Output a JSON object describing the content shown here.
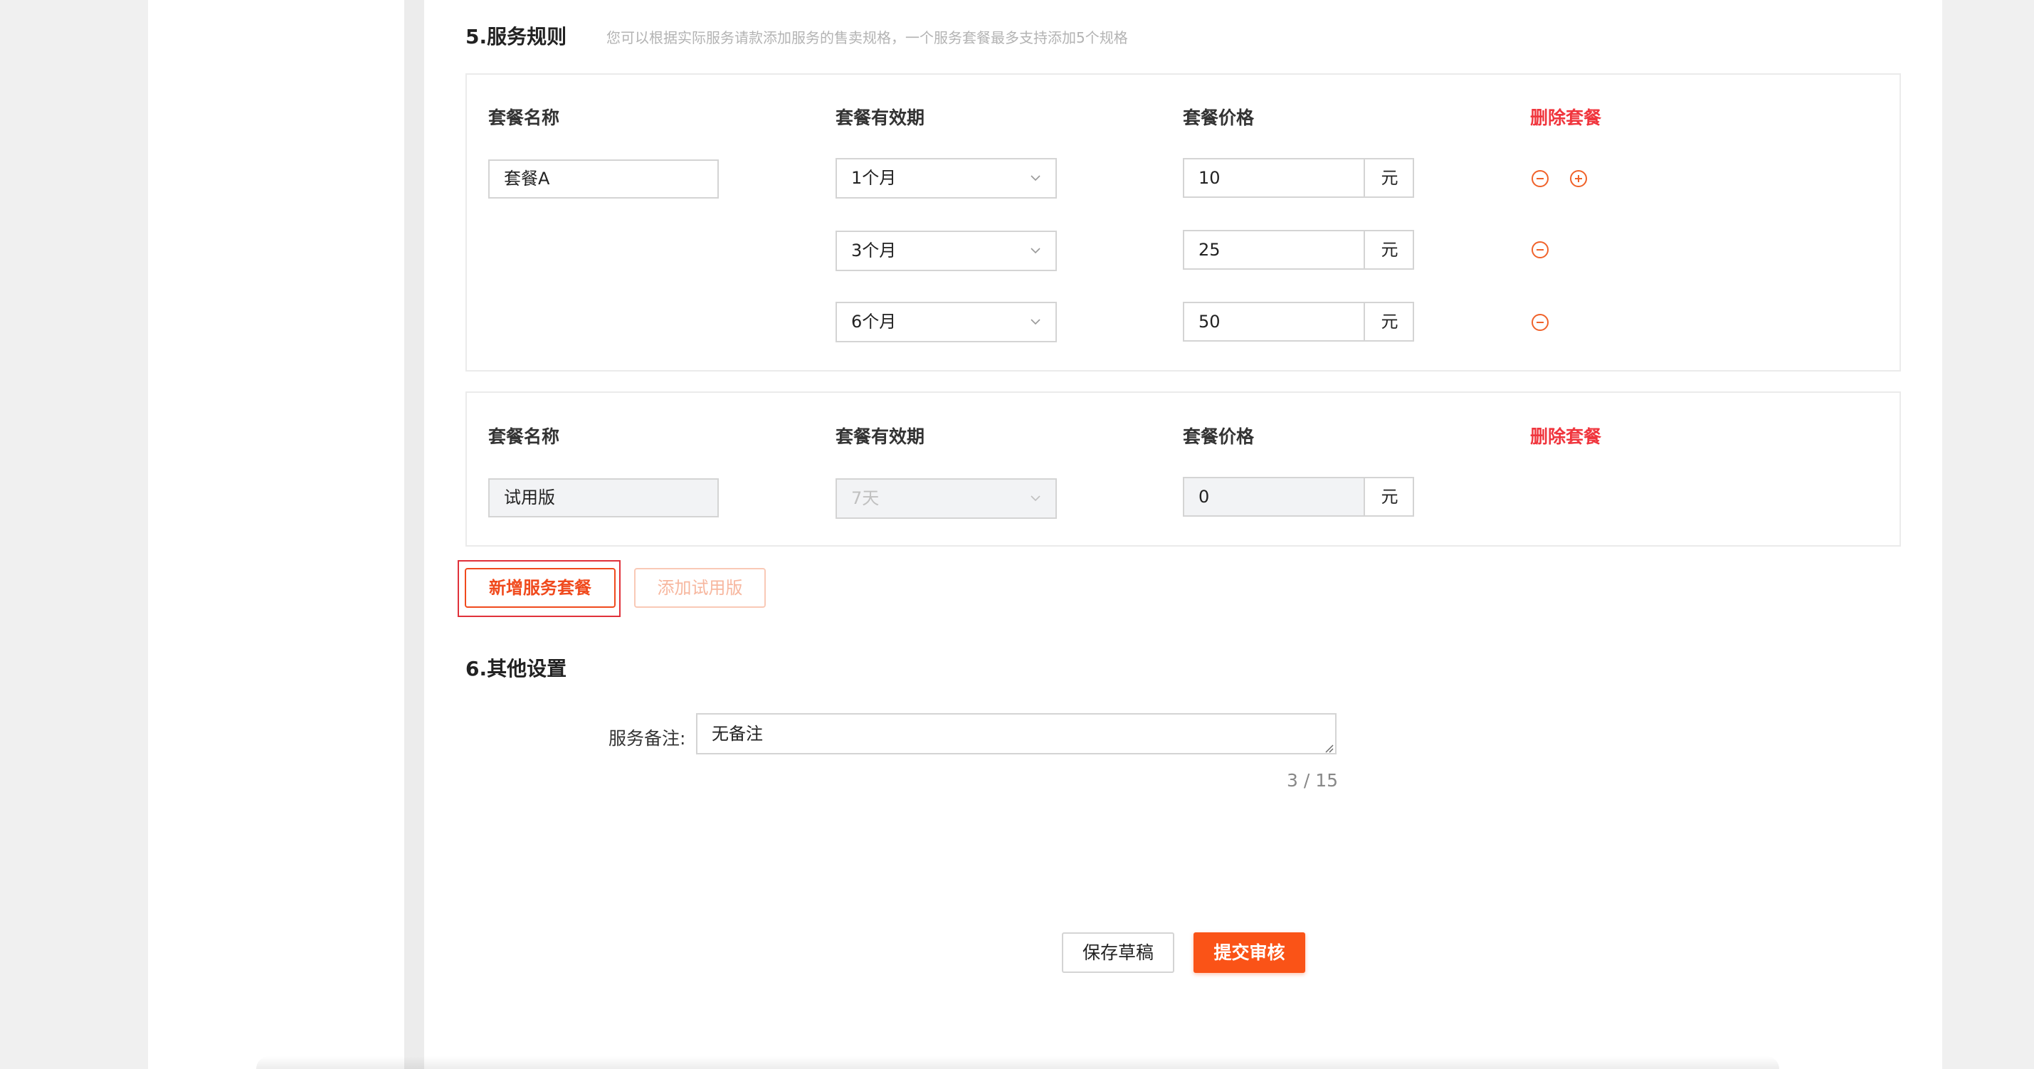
{
  "section5": {
    "title": "5.服务规则",
    "hint": "您可以根据实际服务请款添加服务的售卖规格，一个服务套餐最多支持添加5个规格"
  },
  "columns": {
    "name": "套餐名称",
    "validity": "套餐有效期",
    "price": "套餐价格",
    "delete": "删除套餐"
  },
  "packages": [
    {
      "name": "套餐A",
      "specs": [
        {
          "validity": "1个月",
          "price": "10",
          "unit": "元"
        },
        {
          "validity": "3个月",
          "price": "25",
          "unit": "元"
        },
        {
          "validity": "6个月",
          "price": "50",
          "unit": "元"
        }
      ]
    },
    {
      "name": "试用版",
      "specs": [
        {
          "validity": "7天",
          "price": "0",
          "unit": "元"
        }
      ]
    }
  ],
  "buttons": {
    "add_package": "新增服务套餐",
    "add_trial": "添加试用版",
    "save_draft": "保存草稿",
    "submit_review": "提交审核"
  },
  "section6": {
    "title": "6.其他设置",
    "remark_label": "服务备注:",
    "remark_value": "无备注",
    "char_count": "3 / 15"
  },
  "colors": {
    "accent": "#fa5317",
    "danger": "#f0353d",
    "icon_orange": "#f0622a",
    "border": "#d4d4d4"
  },
  "icons": {
    "remove": "minus-circle-icon",
    "add": "plus-circle-icon",
    "dropdown": "chevron-down-icon"
  }
}
